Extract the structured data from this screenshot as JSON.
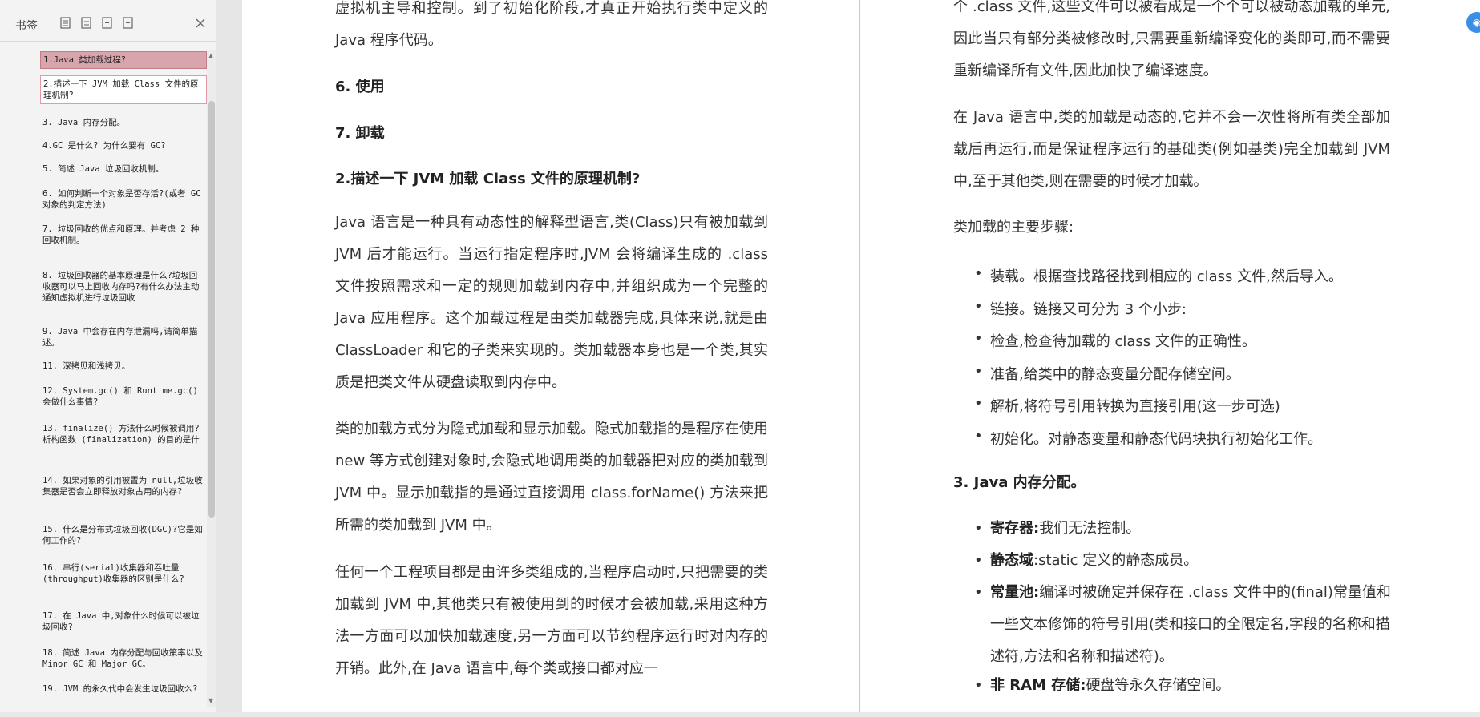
{
  "sidebar": {
    "title": "书签",
    "bookmarks": [
      {
        "label": "1.Java 类加载过程?",
        "state": "active"
      },
      {
        "label": "2.描述一下 JVM 加载 Class 文件的原理机制?",
        "state": "hover"
      },
      {
        "label": "3. Java 内存分配。",
        "state": ""
      },
      {
        "label": "4.GC 是什么? 为什么要有 GC?",
        "state": ""
      },
      {
        "label": "5. 简述 Java 垃圾回收机制。",
        "state": ""
      },
      {
        "label": "6. 如何判断一个对象是否存活?(或者 GC 对象的判定方法)",
        "state": ""
      },
      {
        "label": "7. 垃圾回收的优点和原理。并考虑 2 种回收机制。",
        "state": ""
      },
      {
        "label": "8. 垃圾回收器的基本原理是什么?垃圾回收器可以马上回收内存吗?有什么办法主动通知虚拟机进行垃圾回收",
        "state": ""
      },
      {
        "label": "9. Java 中会存在内存泄漏吗,请简单描述。",
        "state": ""
      },
      {
        "label": "11. 深拷贝和浅拷贝。",
        "state": ""
      },
      {
        "label": "12. System.gc() 和 Runtime.gc() 会做什么事情?",
        "state": ""
      },
      {
        "label": "13. finalize() 方法什么时候被调用?析构函数 (finalization) 的目的是什",
        "state": ""
      },
      {
        "label": "14. 如果对象的引用被置为 null,垃圾收集器是否会立即释放对象占用的内存?",
        "state": ""
      },
      {
        "label": "15. 什么是分布式垃圾回收(DGC)?它是如何工作的?",
        "state": ""
      },
      {
        "label": "16. 串行(serial)收集器和吞吐量(throughput)收集器的区别是什么?",
        "state": ""
      },
      {
        "label": "17. 在 Java 中,对象什么时候可以被垃圾回收?",
        "state": ""
      },
      {
        "label": "18. 简述 Java 内存分配与回收策率以及 Minor GC 和 Major GC。",
        "state": ""
      },
      {
        "label": "19. JVM 的永久代中会发生垃圾回收么?",
        "state": ""
      }
    ]
  },
  "left_page": {
    "p_top": "虚拟机主导和控制。到了初始化阶段,才真正开始执行类中定义的 Java 程序代码。",
    "h6": "6. 使用",
    "h7": "7. 卸载",
    "h2": "2.描述一下 JVM 加载 Class 文件的原理机制?",
    "p1": "Java 语言是一种具有动态性的解释型语言,类(Class)只有被加载到 JVM 后才能运行。当运行指定程序时,JVM 会将编译生成的 .class 文件按照需求和一定的规则加载到内存中,并组织成为一个完整的 Java 应用程序。这个加载过程是由类加载器完成,具体来说,就是由 ClassLoader 和它的子类来实现的。类加载器本身也是一个类,其实质是把类文件从硬盘读取到内存中。",
    "p2": "类的加载方式分为隐式加载和显示加载。隐式加载指的是程序在使用 new 等方式创建对象时,会隐式地调用类的加载器把对应的类加载到 JVM 中。显示加载指的是通过直接调用 class.forName() 方法来把所需的类加载到 JVM 中。",
    "p3": "任何一个工程项目都是由许多类组成的,当程序启动时,只把需要的类加载到 JVM 中,其他类只有被使用到的时候才会被加载,采用这种方法一方面可以加快加载速度,另一方面可以节约程序运行时对内存的开销。此外,在 Java 语言中,每个类或接口都对应一"
  },
  "right_page": {
    "p_top": "个 .class 文件,这些文件可以被看成是一个个可以被动态加载的单元,因此当只有部分类被修改时,只需要重新编译变化的类即可,而不需要重新编译所有文件,因此加快了编译速度。",
    "p1": "在 Java 语言中,类的加载是动态的,它并不会一次性将所有类全部加载后再运行,而是保证程序运行的基础类(例如基类)完全加载到 JVM 中,至于其他类,则在需要的时候才加载。",
    "p2": "类加载的主要步骤:",
    "steps": [
      "装载。根据查找路径找到相应的 class 文件,然后导入。",
      "链接。链接又可分为 3 个小步:",
      "检查,检查待加载的 class 文件的正确性。",
      "准备,给类中的静态变量分配存储空间。",
      "解析,将符号引用转换为直接引用(这一步可选)",
      "初始化。对静态变量和静态代码块执行初始化工作。"
    ],
    "h3": "3. Java 内存分配。",
    "mem": [
      {
        "k": "寄存器:",
        "v": "我们无法控制。"
      },
      {
        "k": "静态域",
        "v": ":static 定义的静态成员。"
      },
      {
        "k": "常量池:",
        "v": "编译时被确定并保存在 .class 文件中的(final)常量值和一些文本修饰的符号引用(类和接口的全限定名,字段的名称和描述符,方法和名称和描述符)。"
      },
      {
        "k": "非 RAM 存储:",
        "v": "硬盘等永久存储空间。"
      }
    ]
  },
  "colors": {
    "active_bookmark": "#d8a5ad",
    "badge": "#3b8ee8"
  }
}
